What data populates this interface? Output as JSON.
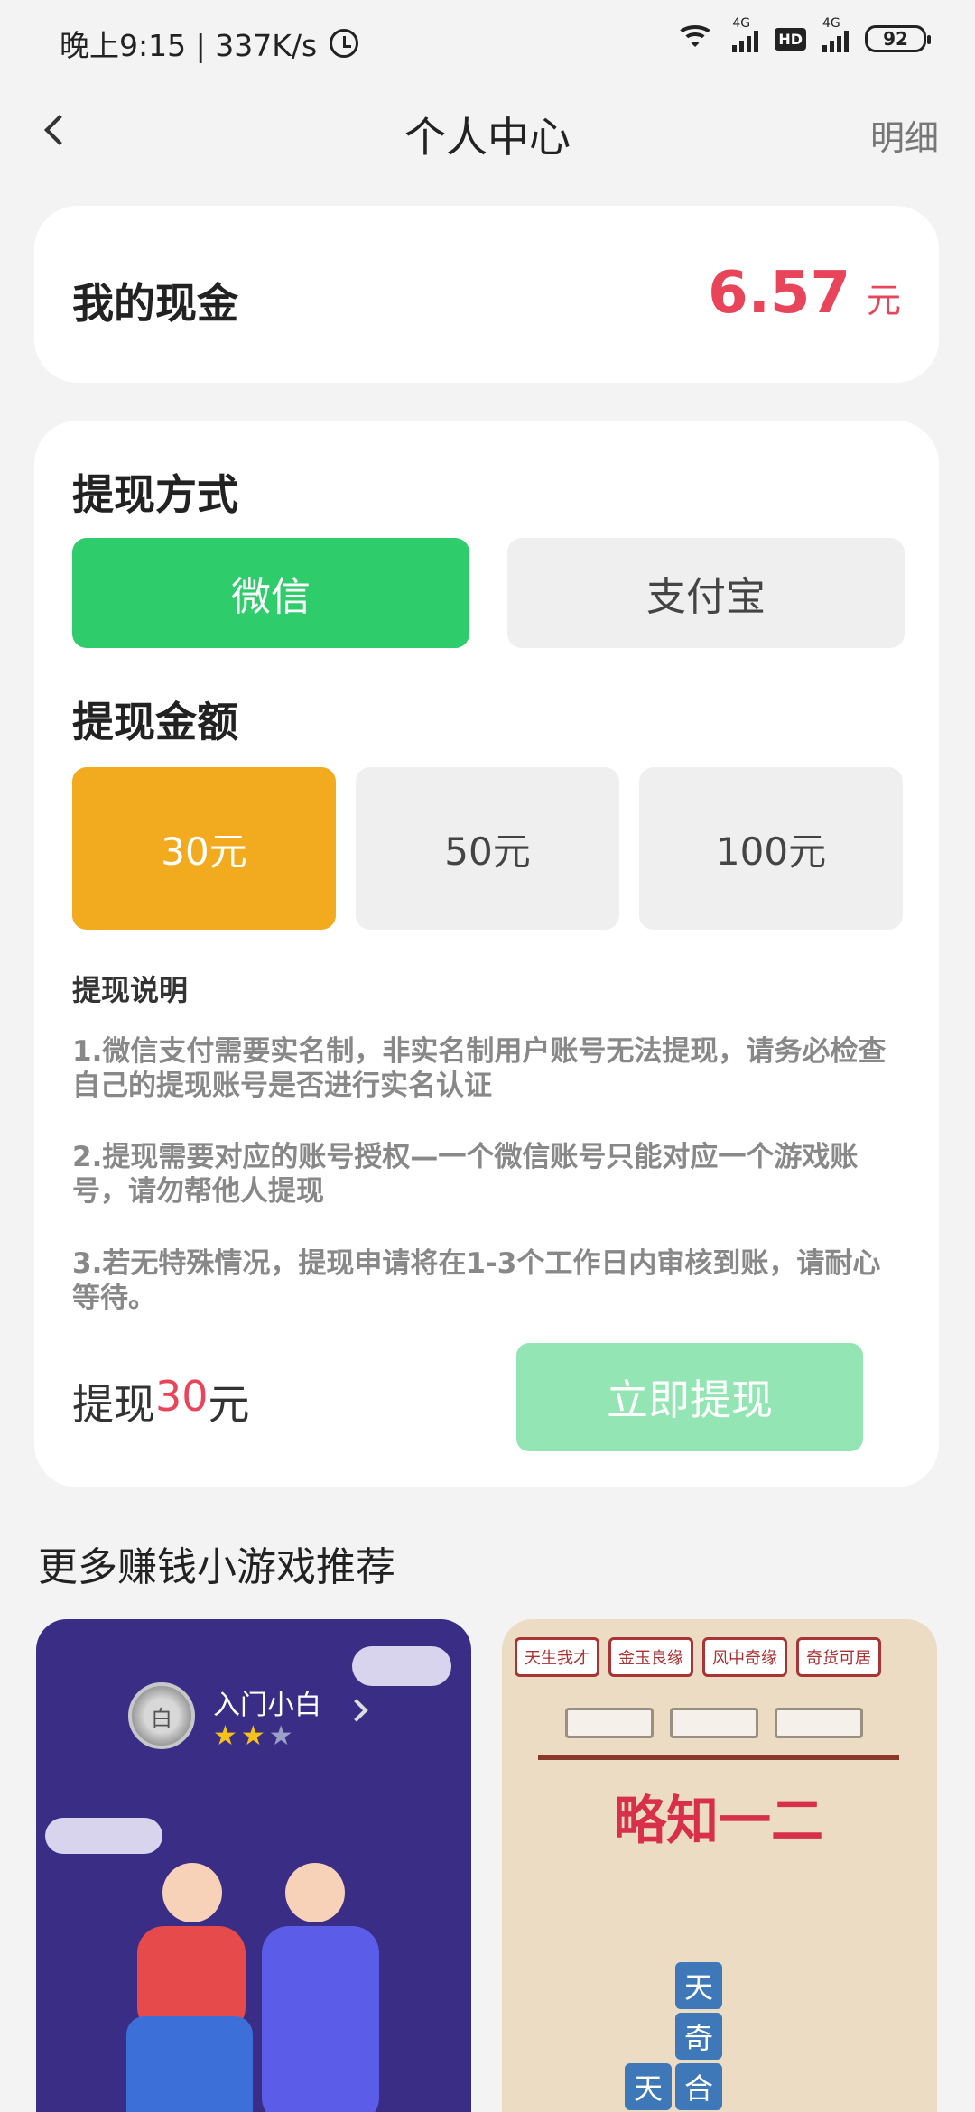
{
  "status": {
    "time_speed": "晚上9:15 | 337K/s",
    "net1": "4G",
    "net2": "4G",
    "hd": "HD",
    "battery": "92"
  },
  "header": {
    "title": "个人中心",
    "detail": "明细"
  },
  "cash": {
    "label": "我的现金",
    "amount": "6.57",
    "unit": "元"
  },
  "withdraw": {
    "method_title": "提现方式",
    "methods": [
      "微信",
      "支付宝"
    ],
    "amount_title": "提现金额",
    "amounts": [
      "30元",
      "50元",
      "100元"
    ],
    "notes_title": "提现说明",
    "notes": [
      "1.微信支付需要实名制，非实名制用户账号无法提现，请务必检查自己的提现账号是否进行实名认证",
      "2.提现需要对应的账号授权—一个微信账号只能对应一个游戏账号，请勿帮他人提现",
      "3.若无特殊情况，提现申请将在1-3个工作日内审核到账，请耐心等待。"
    ],
    "summary_prefix": "提现",
    "summary_amount": "30",
    "summary_unit": "元",
    "submit": "立即提现"
  },
  "more": {
    "title": "更多赚钱小游戏推荐",
    "game1": {
      "badge_name": "入门小白",
      "badge_icon_text": "白",
      "stars": "★★",
      "star_off": "★"
    },
    "game2": {
      "tabs": [
        "天生我才",
        "金玉良缘",
        "风中奇缘",
        "奇货可居"
      ],
      "banner": "略知一二",
      "tiles": [
        "天",
        "奇",
        "天",
        "合"
      ]
    }
  },
  "colors": {
    "accent_red": "#e8455a",
    "wechat_green": "#2ecc6a",
    "selected_amount": "#f2ab1e",
    "submit_disabled": "#93e6b3"
  }
}
